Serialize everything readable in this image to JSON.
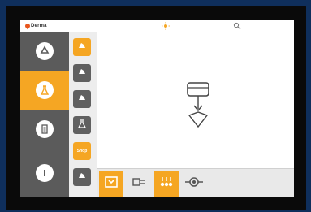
{
  "brand": {
    "name": "Derma"
  },
  "topbar": {
    "icons": [
      "sun-icon",
      "search-icon"
    ]
  },
  "sidebar": {
    "items": [
      {
        "icon": "recycle-icon",
        "active": false
      },
      {
        "icon": "flask-icon",
        "active": true
      },
      {
        "icon": "list-icon",
        "active": false
      },
      {
        "icon": "info-icon",
        "active": false
      }
    ]
  },
  "tools": {
    "items": [
      {
        "icon": "hand-icon",
        "active": true
      },
      {
        "icon": "hand-icon",
        "active": false
      },
      {
        "icon": "hand-icon",
        "active": false
      },
      {
        "icon": "flask-icon",
        "active": false
      },
      {
        "label": "Shop",
        "active": true
      },
      {
        "icon": "hand-icon",
        "active": false
      }
    ]
  },
  "main": {
    "icon": "dispense-icon"
  },
  "bottombar": {
    "items": [
      {
        "icon": "tray-icon",
        "active": true
      },
      {
        "icon": "plug-icon",
        "active": false
      },
      {
        "icon": "droplets-icon",
        "active": true
      },
      {
        "icon": "pump-icon",
        "active": false
      }
    ]
  },
  "colors": {
    "accent": "#f5a623",
    "sidebar": "#5b5b5b",
    "bezel": "#0f2f5c"
  }
}
